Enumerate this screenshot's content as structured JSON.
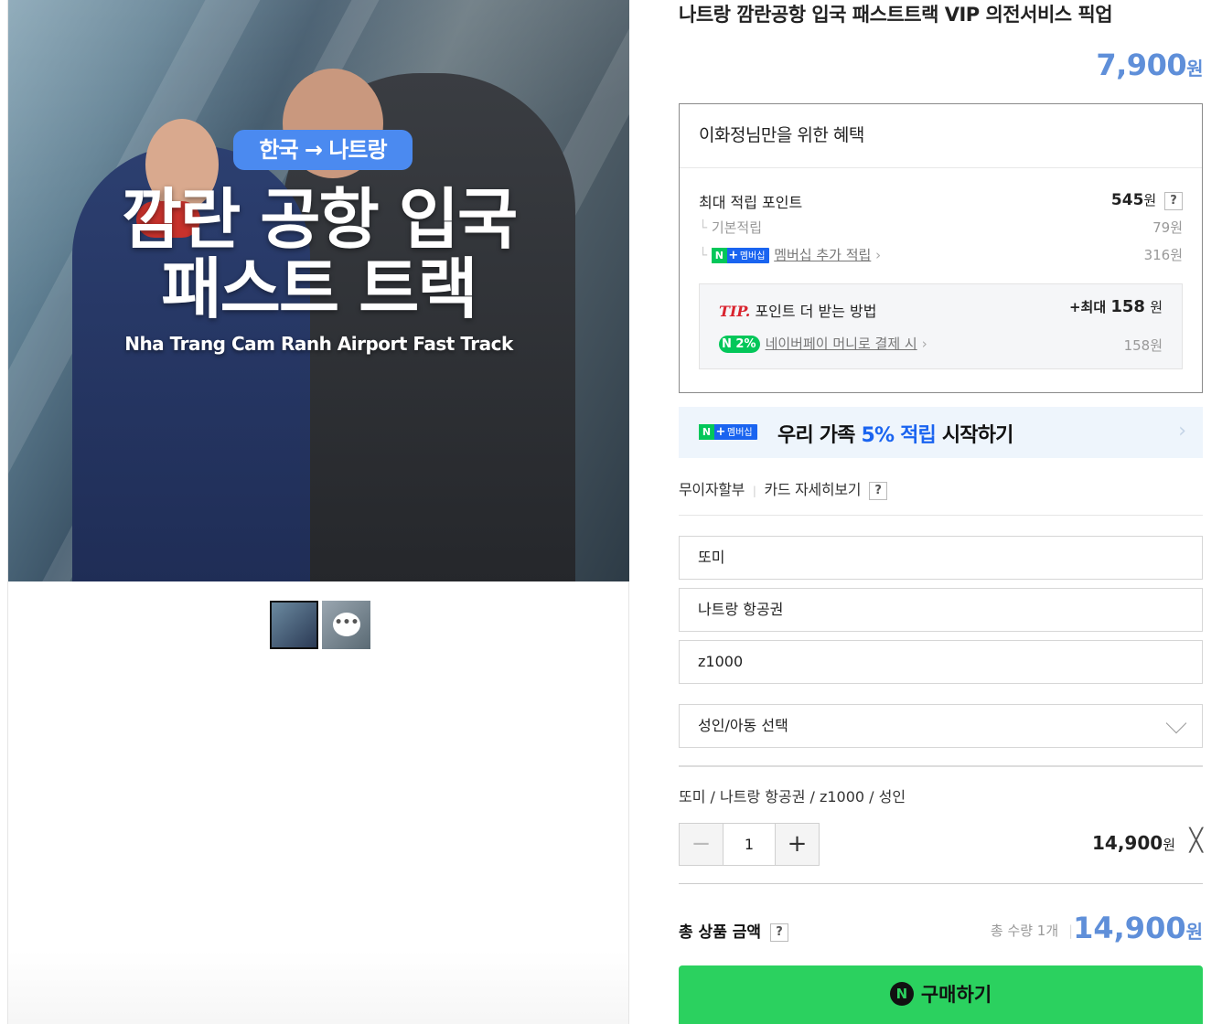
{
  "hero": {
    "badge": "한국 → 나트랑",
    "headline_line1": "깜란 공항 입국",
    "headline_line2": "패스트 트랙",
    "subtitle_en": "Nha Trang Cam Ranh Airport Fast Track"
  },
  "product": {
    "title": "나트랑 깜란공항 입국 패스트트랙 VIP 의전서비스 픽업",
    "price": "7,900",
    "price_unit": "원"
  },
  "benefits": {
    "heading": "이화정님만을 위한 혜택",
    "max_points_label": "최대 적립 포인트",
    "max_points_value": "545",
    "max_points_unit": "원",
    "help": "?",
    "basic_label": "기본적립",
    "basic_value": "79원",
    "membership_badge_n": "N",
    "membership_badge_plus": "+",
    "membership_badge_text": "멤버십",
    "membership_label": "멤버십 추가 적립",
    "membership_value": "316원",
    "tip_prefix": "TIP.",
    "tip_label": "포인트 더 받는 방법",
    "tip_max_prefix": "+최대",
    "tip_max_value": "158",
    "tip_max_unit": "원",
    "npay_badge": "N 2%",
    "npay_label": "네이버페이 머니로 결제 시",
    "npay_value": "158원"
  },
  "banner": {
    "badge_n": "N",
    "badge_plus": "+",
    "badge_text": "멤버십",
    "text_before": "우리 가족 ",
    "text_highlight": "5% 적립",
    "text_after": " 시작하기",
    "arrow": "›"
  },
  "installment": {
    "label1": "무이자할부",
    "separator": "|",
    "label2": "카드 자세히보기",
    "help": "?"
  },
  "options": {
    "field1": "또미",
    "field2": "나트랑 항공권",
    "field3": "z1000",
    "select_label": "성인/아동 선택"
  },
  "selected": {
    "summary": "또미 / 나트랑 항공권 / z1000 / 성인",
    "minus": "−",
    "quantity": "1",
    "plus": "+",
    "price": "14,900",
    "price_unit": "원",
    "remove": "╳"
  },
  "total": {
    "label": "총 상품 금액",
    "help": "?",
    "count": "총 수량 1개",
    "separator": "|",
    "price": "14,900",
    "price_unit": "원"
  },
  "buy": {
    "icon": "N",
    "label": "구매하기"
  },
  "thumbnails": {
    "more": "•••"
  },
  "colors": {
    "accent_price": "#5f8fd9",
    "naver_green": "#03c75a",
    "buy_green": "#2bd15f",
    "membership_blue": "#1a64f0",
    "tip_red": "#d9232e"
  }
}
